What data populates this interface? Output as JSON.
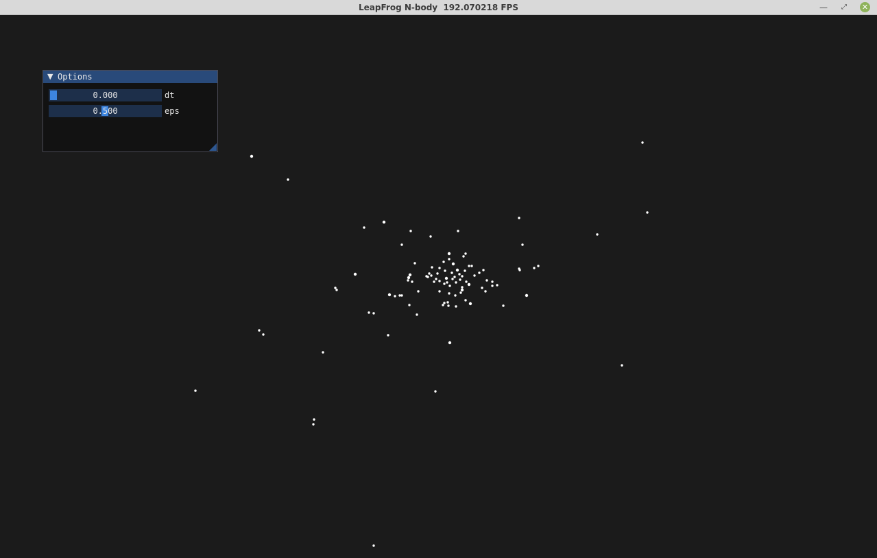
{
  "window": {
    "title": "LeapFrog N-body  192.070218 FPS",
    "controls": {
      "minimize": "—",
      "maximize": "⤢",
      "close": "✕"
    }
  },
  "options_panel": {
    "collapse_arrow": "▼",
    "title": "Options",
    "sliders": [
      {
        "label": "dt",
        "value": "0.000",
        "fraction": 0.0
      },
      {
        "label": "eps",
        "value": "0.500",
        "fraction": 0.5
      }
    ]
  },
  "colors": {
    "background": "#1b1b1b",
    "titlebar": "#d9d9d9",
    "panel_header": "#294a7a",
    "slider_frame": "#1d2f4a",
    "slider_grab": "#3d85e0",
    "particle": "#ffffff",
    "close_button": "#8fb35a"
  }
}
